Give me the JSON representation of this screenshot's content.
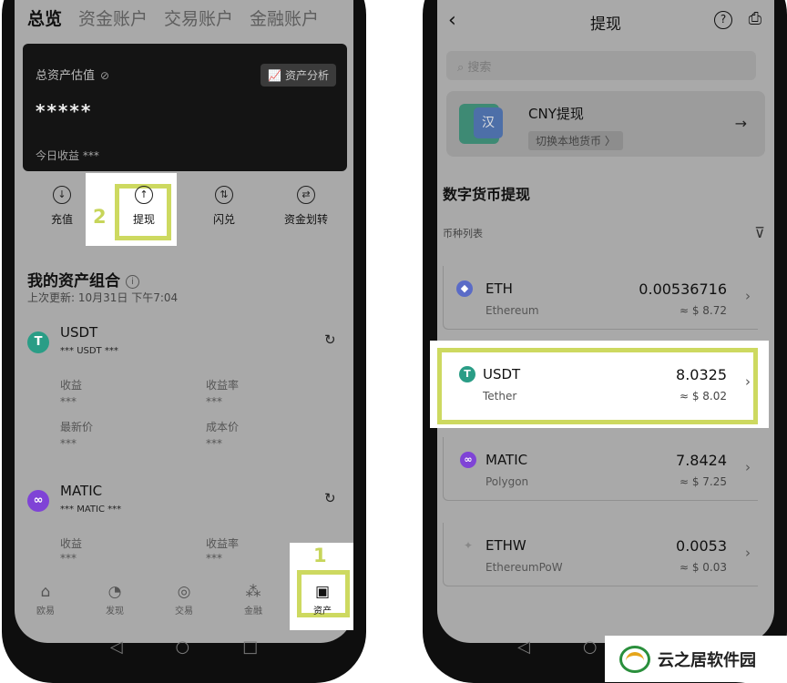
{
  "left": {
    "tabs": [
      "总览",
      "资金账户",
      "交易账户",
      "金融账户"
    ],
    "asset_card": {
      "label": "总资产估值",
      "analysis_button": "资产分析",
      "value": "*****",
      "today": "今日收益 ***"
    },
    "actions": [
      {
        "label": "充值",
        "icon": "deposit-icon"
      },
      {
        "label": "提现",
        "icon": "withdraw-icon"
      },
      {
        "label": "闪兑",
        "icon": "swap-icon"
      },
      {
        "label": "资金划转",
        "icon": "transfer-icon"
      }
    ],
    "step_2": "2",
    "portfolio": {
      "title": "我的资产组合",
      "updated": "上次更新: 10月31日 下午7:04"
    },
    "coins": [
      {
        "name": "USDT",
        "amount": "***",
        "unit": "USDT",
        "unit_value": "***",
        "fields": [
          {
            "label": "收益",
            "value": "***"
          },
          {
            "label": "收益率",
            "value": "***"
          },
          {
            "label": "最新价",
            "value": "***"
          },
          {
            "label": "成本价",
            "value": "***"
          }
        ]
      },
      {
        "name": "MATIC",
        "amount": "***",
        "unit": "MATIC",
        "unit_value": "***",
        "fields": [
          {
            "label": "收益",
            "value": "***"
          },
          {
            "label": "收益率",
            "value": "***"
          }
        ]
      }
    ],
    "bottom_nav": [
      "欧易",
      "发现",
      "交易",
      "金融",
      "资产"
    ],
    "step_1": "1"
  },
  "right": {
    "header_title": "提现",
    "search_placeholder": "搜索",
    "cny": {
      "title": "CNY提现",
      "subtitle": "切换本地货币 〉",
      "icon_text": "汉"
    },
    "section_title": "数字货币提现",
    "list_label": "币种列表",
    "coins": [
      {
        "symbol": "ETH",
        "name": "Ethereum",
        "amount": "0.00536716",
        "usd": "≈ $ 8.72"
      },
      {
        "symbol": "USDT",
        "name": "Tether",
        "amount": "8.0325",
        "usd": "≈ $ 8.02"
      },
      {
        "symbol": "MATIC",
        "name": "Polygon",
        "amount": "7.8424",
        "usd": "≈ $ 7.25"
      },
      {
        "symbol": "ETHW",
        "name": "EthereumPoW",
        "amount": "0.0053",
        "usd": "≈ $ 0.03"
      }
    ]
  },
  "watermark": "云之居软件园",
  "colors": {
    "highlight": "#cdd960",
    "tether": "#2a9d86",
    "matic": "#7f43d6",
    "eth": "#5a6bc7"
  }
}
